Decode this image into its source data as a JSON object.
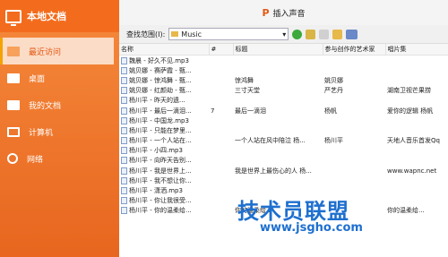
{
  "sidebar": {
    "title": "本地文档",
    "items": [
      {
        "label": "最近访问",
        "icon": "recent-folder-icon"
      },
      {
        "label": "桌面",
        "icon": "desktop-folder-icon"
      },
      {
        "label": "我的文档",
        "icon": "documents-folder-icon"
      },
      {
        "label": "计算机",
        "icon": "computer-icon"
      },
      {
        "label": "网络",
        "icon": "network-icon"
      }
    ]
  },
  "dialog": {
    "title": "插入声音",
    "look_in_label": "查找范围(I):",
    "look_in_value": "Music"
  },
  "columns": [
    "名称",
    "#",
    "标题",
    "参与创作的艺术家",
    "唱片集"
  ],
  "files": [
    {
      "name": "魏晨 - 好久不见.mp3",
      "num": "",
      "title": "",
      "artist": "",
      "album": ""
    },
    {
      "name": "姚贝娜 - 赛萨霞 - 甄...",
      "num": "",
      "title": "",
      "artist": "",
      "album": ""
    },
    {
      "name": "姚贝娜 - 惊鸿舞 - 甄...",
      "num": "",
      "title": "惊鸿舞",
      "artist": "姚贝娜",
      "album": ""
    },
    {
      "name": "姚贝娜 - 红颜劫 - 甄...",
      "num": "",
      "title": "三寸天堂",
      "artist": "严艺丹",
      "album": "湖南卫视芒果捞"
    },
    {
      "name": "杨川平 - 昨天的遗...",
      "num": "",
      "title": "",
      "artist": "",
      "album": ""
    },
    {
      "name": "杨川平 - 最后一滴泪...",
      "num": "7",
      "title": "最后一滴泪",
      "artist": "杨帆",
      "album": "爱你的逻辑 杨帆"
    },
    {
      "name": "杨川平 - 中国龙.mp3",
      "num": "",
      "title": "",
      "artist": "",
      "album": ""
    },
    {
      "name": "杨川平 - 只能在梦里...",
      "num": "",
      "title": "",
      "artist": "",
      "album": ""
    },
    {
      "name": "杨川平 - 一个人站在...",
      "num": "",
      "title": "一个人站在风中陪泣 杨...",
      "artist": "杨川平",
      "album": "天地人音乐首发Qq"
    },
    {
      "name": "杨川平 - 小四.mp3",
      "num": "",
      "title": "",
      "artist": "",
      "album": ""
    },
    {
      "name": "杨川平 - 向昨天告别...",
      "num": "",
      "title": "",
      "artist": "",
      "album": ""
    },
    {
      "name": "杨川平 - 我是世界上...",
      "num": "",
      "title": "我是世界上最伤心的人 杨...",
      "artist": "",
      "album": "www.wapnc.net"
    },
    {
      "name": "杨川平 - 我不想让你...",
      "num": "",
      "title": "",
      "artist": "",
      "album": ""
    },
    {
      "name": "杨川平 - 潇洒.mp3",
      "num": "",
      "title": "",
      "artist": "",
      "album": ""
    },
    {
      "name": "杨川平 - 你让我很受...",
      "num": "",
      "title": "",
      "artist": "",
      "album": ""
    },
    {
      "name": "杨川平 - 你的温柔给...",
      "num": "",
      "title": "你的温柔给...",
      "artist": "",
      "album": "你的温柔给..."
    }
  ],
  "watermark": {
    "brand": "技术员联盟",
    "url": "www.jsgho.com"
  },
  "colors": {
    "sidebar_orange": "#f36c1d",
    "active_item_bg": "#fbdcc6",
    "watermark_blue": "#1e6fcf"
  }
}
